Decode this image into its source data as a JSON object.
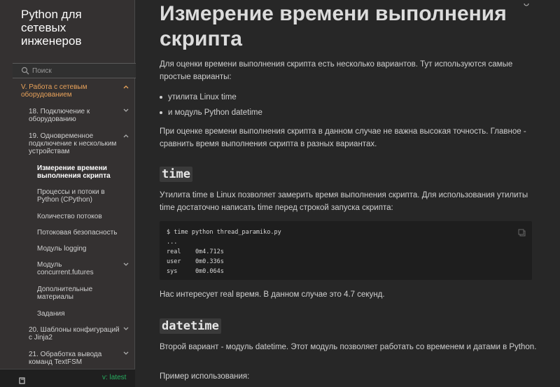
{
  "sidebar": {
    "brand": "Python для сетевых инженеров",
    "search_placeholder": "Поиск",
    "items": [
      {
        "label": "V. Работа с сетевым оборудованием"
      },
      {
        "label": "18. Подключение к оборудованию"
      },
      {
        "label": "19. Одновременное подключение к нескольким устройствам"
      },
      {
        "label": "Измерение времени выполнения скрипта"
      },
      {
        "label": "Процессы и потоки в Python (CPython)"
      },
      {
        "label": "Количество потоков"
      },
      {
        "label": "Потоковая безопасность"
      },
      {
        "label": "Модуль logging"
      },
      {
        "label": "Модуль concurrent.futures"
      },
      {
        "label": "Дополнительные материалы"
      },
      {
        "label": "Задания"
      },
      {
        "label": "20. Шаблоны конфигураций с Jinja2"
      },
      {
        "label": "21. Обработка вывода команд TextFSM"
      }
    ],
    "version": "v: latest",
    "colors": {
      "active": "#e8a25a",
      "version": "#27ae60"
    }
  },
  "main": {
    "title": "Измерение времени выполнения скрипта",
    "intro": "Для оценки времени выполнения скрипта есть несколько вариантов. Тут используются самые простые варианты:",
    "bullets": [
      "утилита Linux time",
      "и модуль Python datetime"
    ],
    "note": "При оценке времени выполнения скрипта в данном случае не важна высокая точность. Главное - сравнить время выполнения скрипта в разных вариантах.",
    "section1": {
      "heading": "time",
      "text": "Утилита time в Linux позволяет замерить время выполнения скрипта. Для использования утилиты time достаточно написать time перед строкой запуска скрипта:",
      "code": "$ time python thread_paramiko.py\n...\nreal    0m4.712s\nuser    0m0.336s\nsys     0m0.064s",
      "after": "Нас интересует real время. В данном случае это 4.7 секунд."
    },
    "section2": {
      "heading": "datetime",
      "text": "Второй вариант - модуль datetime. Этот модуль позволяет работать со временем и датами в Python.",
      "after": "Пример использования:"
    }
  }
}
